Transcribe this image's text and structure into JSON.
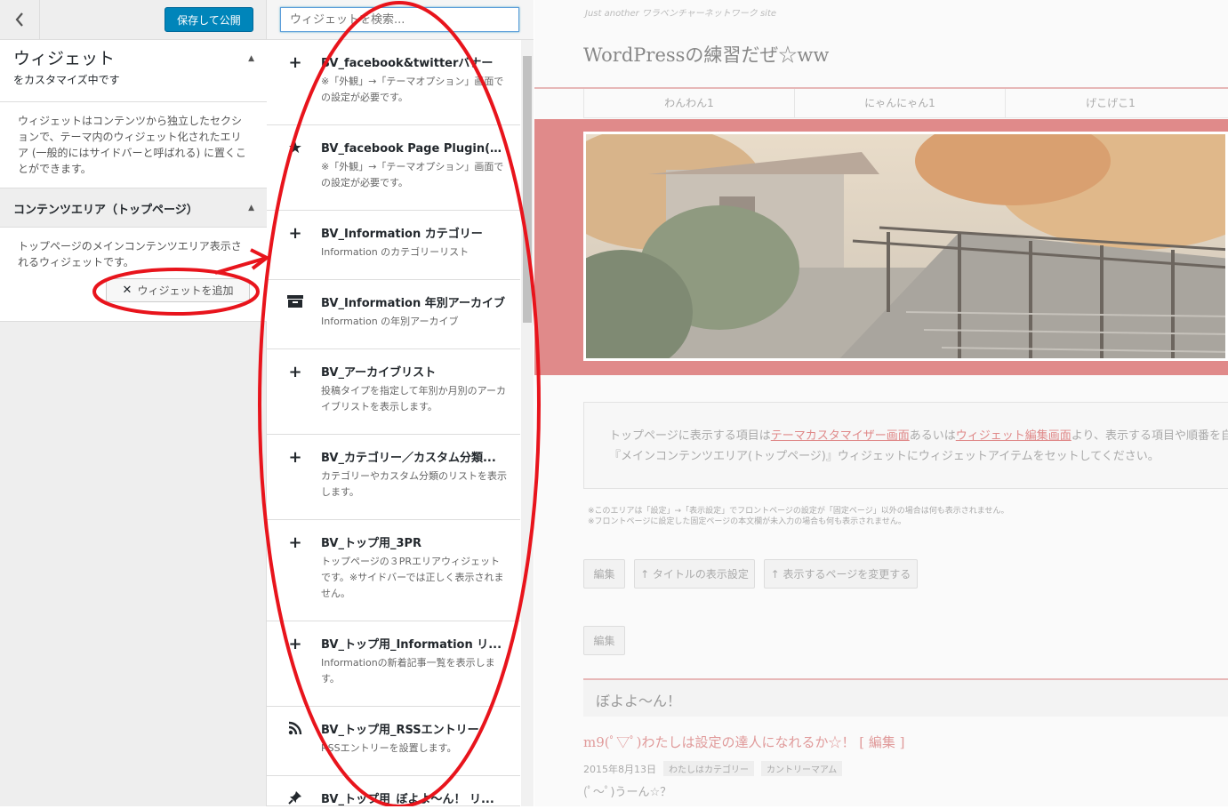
{
  "customizer": {
    "back_icon": "chevron-left-icon",
    "publish_label": "保存して公開",
    "title": "ウィジェット",
    "subtitle": "をカスタマイズ中です",
    "description": "ウィジェットはコンテンツから独立したセクションで、テーマ内のウィジェット化されたエリア (一般的にはサイドバーと呼ばれる) に置くことができます。",
    "area_title": "コンテンツエリア（トップページ）",
    "area_description": "トップページのメインコンテンツエリア表示されるウィジェットです。",
    "add_widget_label": "ウィジェットを追加"
  },
  "widget_list": {
    "search_placeholder": "ウィジェットを検索...",
    "items": [
      {
        "icon": "plus-icon",
        "name": "BV_facebook&twitterバナー",
        "desc": "※「外観」→「テーマオプション」画面での設定が必要です。"
      },
      {
        "icon": "star-icon",
        "name": "BV_facebook Page Plugin(Lik...",
        "desc": "※「外観」→「テーマオプション」画面での設定が必要です。"
      },
      {
        "icon": "plus-icon",
        "name": "BV_Information カテゴリー",
        "desc": "Information のカテゴリーリスト"
      },
      {
        "icon": "archive-icon",
        "name": "BV_Information 年別アーカイブ",
        "desc": "Information の年別アーカイブ"
      },
      {
        "icon": "plus-icon",
        "name": "BV_アーカイブリスト",
        "desc": "投稿タイプを指定して年別か月別のアーカイブリストを表示します。"
      },
      {
        "icon": "plus-icon",
        "name": "BV_カテゴリー／カスタム分類...",
        "desc": "カテゴリーやカスタム分類のリストを表示します。"
      },
      {
        "icon": "plus-icon",
        "name": "BV_トップ用_3PR",
        "desc": "トップページの３PRエリアウィジェットです。※サイドバーでは正しく表示されません。"
      },
      {
        "icon": "plus-icon",
        "name": "BV_トップ用_Information リ...",
        "desc": "Informationの新着記事一覧を表示します。"
      },
      {
        "icon": "rss-icon",
        "name": "BV_トップ用_RSSエントリー",
        "desc": "RSSエントリーを設置します。"
      },
      {
        "icon": "pin-icon",
        "name": "BV_トップ用_ぼよよ〜ん！ リ...",
        "desc": ""
      }
    ]
  },
  "preview": {
    "tagline": "Just another ワラベンチャーネットワーク site",
    "site_title": "WordPressの練習だぜ☆ww",
    "nav": [
      "わんわん1",
      "にゃんにゃん1",
      "げこげこ1"
    ],
    "info_pre": "トップページに表示する項目は",
    "info_link1": "テーマカスタマイザー画面",
    "info_mid": "あるいは",
    "info_link2": "ウィジェット編集画面",
    "info_post": "より、表示する項目や順番を自由",
    "info_line2": "『メインコンテンツエリア(トップページ)』ウィジェットにウィジェットアイテムをセットしてください。",
    "note1": "※このエリアは「設定」→「表示設定」でフロントページの設定が「固定ページ」以外の場合は何も表示されません。",
    "note2": "※フロントページに設定した固定ページの本文欄が未入力の場合も何も表示されません。",
    "btn_edit": "編集",
    "btn_title_setting": "↑ タイトルの表示設定",
    "btn_change_page": "↑ 表示するページを変更する",
    "btn_edit2": "編集",
    "section_title": "ぼよよ〜ん！",
    "post_title": "m9(ﾟ▽ﾟ)わたしは設定の達人になれるか☆！ [ 編集 ]",
    "post_date": "2015年8月13日",
    "post_tag1": "わたしはカテゴリー",
    "post_tag2": "カントリーマアム",
    "post_body": "(ﾟ〜ﾟ)うーん☆？"
  },
  "colors": {
    "publish_blue": "#0085ba",
    "annotation_red": "#e8141c",
    "hero_pink": "#e08a8a"
  }
}
